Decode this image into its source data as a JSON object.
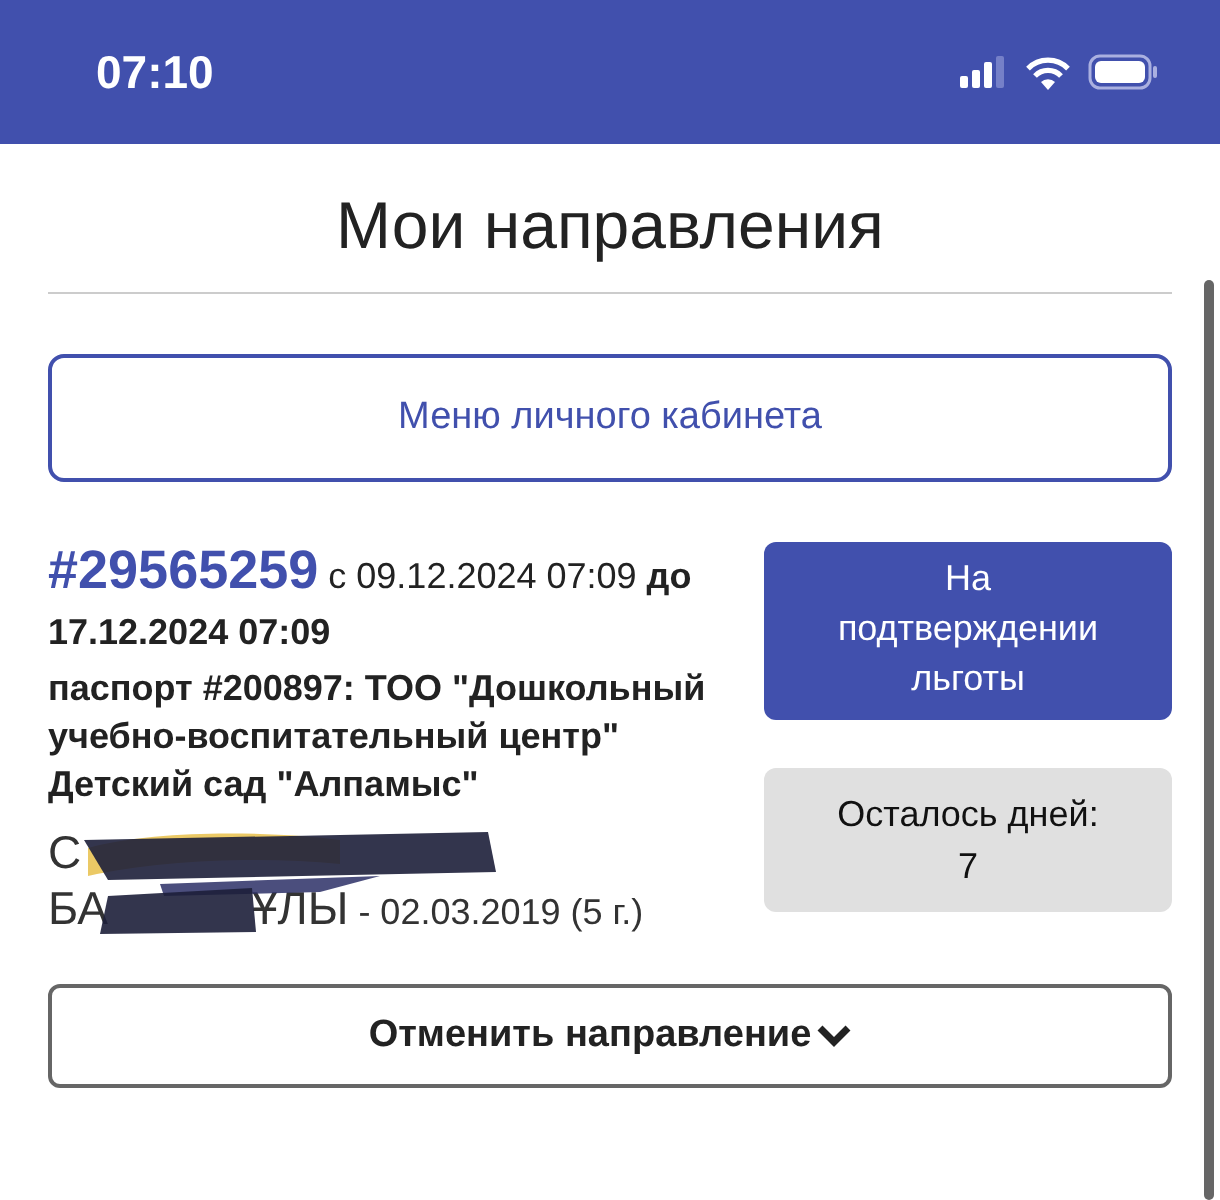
{
  "status_bar": {
    "time": "07:10"
  },
  "header": {
    "title": "Мои направления"
  },
  "menu_button": {
    "label": "Меню личного кабинета"
  },
  "referral": {
    "number": "#29565259",
    "from_prefix": "с",
    "from_date": "09.12.2024 07:09",
    "to_prefix": "до",
    "to_date": "17.12.2024 07:09",
    "institution": "паспорт #200897: ТОО \"Дошкольный учебно-воспитательный центр\" Детский сад \"Алпамыс\"",
    "child_name_line_1": "С",
    "child_name_line_2": "БА",
    "child_name_rest": "ҰЛЫ",
    "birth_info": " - 02.03.2019 (5 г.)",
    "status": "На подтверждении льготы",
    "days_left_label": "Осталось дней:",
    "days_left": "7"
  },
  "cancel_button": {
    "label": "Отменить направление"
  }
}
